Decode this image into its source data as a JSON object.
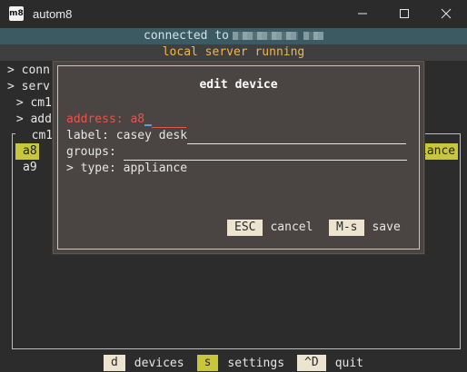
{
  "window": {
    "icon_text": "m8",
    "title": "autom8",
    "controls": [
      "minimize-icon",
      "maximize-icon",
      "close-icon"
    ]
  },
  "status": {
    "connection": "connected to",
    "server": "local server running"
  },
  "tree": {
    "items": [
      {
        "prefix": "> ",
        "label": "conn"
      },
      {
        "prefix": "> ",
        "label": "serv"
      },
      {
        "prefix": " > ",
        "label": "cm1"
      },
      {
        "prefix": " > ",
        "label": "add"
      },
      {
        "prefix": "  ",
        "label": "cm1"
      }
    ]
  },
  "devices": {
    "rows": [
      {
        "label": "a8",
        "tail": "iance",
        "selected": true
      },
      {
        "label": "a9",
        "selected": false
      }
    ]
  },
  "dialog": {
    "title": "edit device",
    "address_label": "address: ",
    "address_value": "a8",
    "label_label": "label: ",
    "label_value": "casey desk",
    "groups_label": "groups: ",
    "type_prefix": "> ",
    "type_label": "type: appliance",
    "cancel_key": "ESC",
    "cancel_label": "cancel",
    "save_key": "M-s",
    "save_label": "save"
  },
  "bottombar": {
    "items": [
      {
        "key": "d",
        "label": "devices",
        "active": false
      },
      {
        "key": "s",
        "label": "settings",
        "active": true
      },
      {
        "key": "^D",
        "label": "quit",
        "active": false
      }
    ]
  },
  "colors": {
    "status_bg": "#3c5a61",
    "server_text": "#f0b64a",
    "selected_row": "#c8c63a",
    "error_red": "#e8544a",
    "key_bg": "#ece4cf"
  }
}
